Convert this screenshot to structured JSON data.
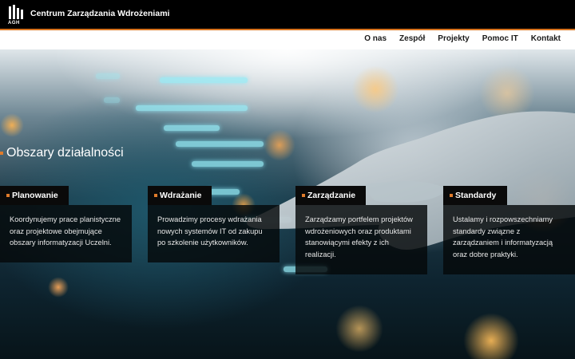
{
  "header": {
    "logo_text": "AGH",
    "title": "Centrum Zarządzania Wdrożeniami"
  },
  "nav": {
    "items": [
      "O nas",
      "Zespół",
      "Projekty",
      "Pomoc IT",
      "Kontakt"
    ]
  },
  "section": {
    "title": "Obszary działalności"
  },
  "cards": [
    {
      "title": "Planowanie",
      "text": "Koordynujemy prace planistyczne oraz projektowe obejmujące obszary informatyzacji Uczelni."
    },
    {
      "title": "Wdrażanie",
      "text": "Prowadzimy procesy wdrażania nowych systemów IT od zakupu po szkolenie użytkowników."
    },
    {
      "title": "Zarządzanie",
      "text": "Zarządzamy portfelem projektów wdrożeniowych oraz produktami stanowiącymi efekty z ich realizacji."
    },
    {
      "title": "Standardy",
      "text": "Ustalamy i rozpowszechniamy standardy związne z zarządzaniem i informatyzacją oraz dobre praktyki."
    }
  ],
  "colors": {
    "accent": "#e07b2a",
    "topbar": "#000000",
    "card_bg": "#0a0a0a"
  }
}
